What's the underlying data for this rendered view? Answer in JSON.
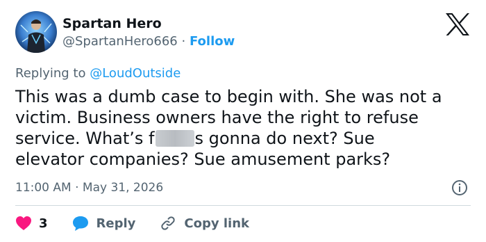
{
  "user": {
    "display_name": "Spartan Hero",
    "handle": "@SpartanHero666",
    "separator": "·",
    "follow_label": "Follow"
  },
  "reply_context": {
    "prefix": "Replying to",
    "mention": "@LoudOutside"
  },
  "tweet": {
    "line1": "This was a dumb case to begin with. She was not a",
    "line2": "victim. Business owners have the right to refuse",
    "line3_pre": "service. What’s f",
    "line3_post": "s gonna do next? Sue",
    "line4": "elevator companies? Sue amusement parks?"
  },
  "meta": {
    "timestamp": "11:00 AM · May 31, 2026"
  },
  "actions": {
    "like_count": "3",
    "reply_label": "Reply",
    "copy_link_label": "Copy link"
  },
  "colors": {
    "accent": "#1d9bf0",
    "like": "#f91880",
    "secondary_text": "#536471",
    "divider": "#cfd9de"
  },
  "icons": {
    "brand": "x-logo-icon",
    "info": "info-icon",
    "like": "heart-icon",
    "reply": "reply-bubble-icon",
    "copy": "link-icon"
  }
}
